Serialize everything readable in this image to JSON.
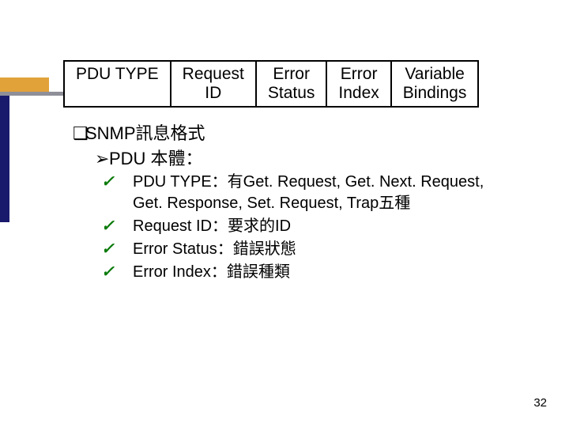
{
  "table": {
    "c0": "PDU TYPE",
    "c1": "Request\nID",
    "c2": "Error\nStatus",
    "c3": "Error\nIndex",
    "c4": "Variable\nBindings"
  },
  "bullets": {
    "h1": "SNMP訊息格式",
    "h2": "PDU 本體：",
    "i1a": "PDU TYPE：有Get. Request, Get. Next. Request,",
    "i1b": "Get. Response, Set. Request, Trap五種",
    "i2": "Request ID：要求的ID",
    "i3": "Error Status：錯誤狀態",
    "i4": "Error Index：錯誤種類"
  },
  "glyphs": {
    "square": "❑",
    "tri": "➢",
    "check": "✓"
  },
  "page": "32"
}
